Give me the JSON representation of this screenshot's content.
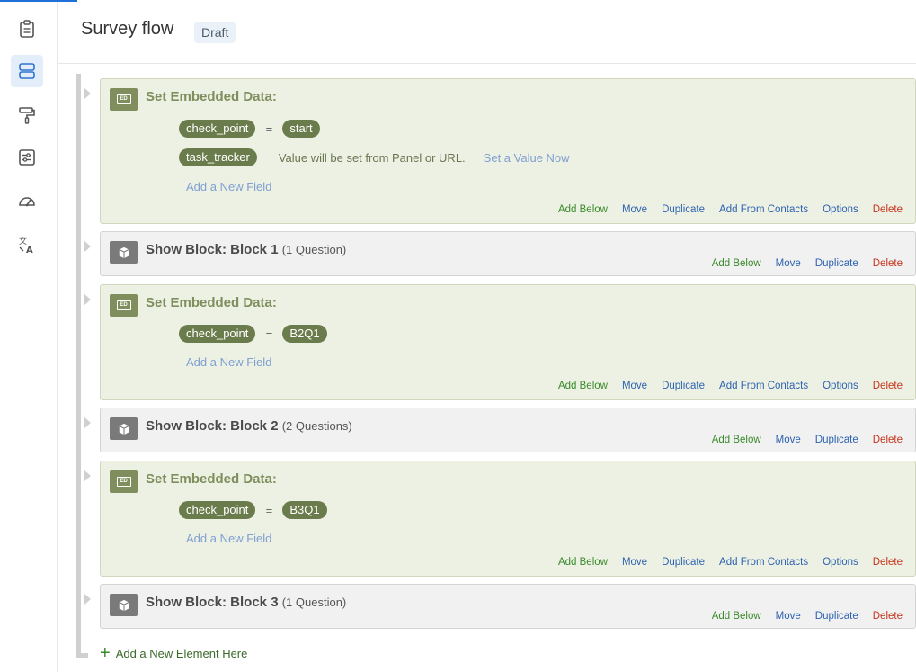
{
  "rail": {
    "items": [
      {
        "icon": "clipboard-icon",
        "active": false
      },
      {
        "icon": "survey-flow-icon",
        "active": true
      },
      {
        "icon": "paint-roller-icon",
        "active": false
      },
      {
        "icon": "survey-options-icon",
        "active": false
      },
      {
        "icon": "gauge-icon",
        "active": false
      },
      {
        "icon": "translate-icon",
        "active": false
      }
    ],
    "accent_color": "#1e6fd9"
  },
  "header": {
    "title": "Survey flow",
    "badge": "Draft"
  },
  "cards": [
    {
      "type": "embedded-data",
      "icon_text": "ED",
      "title": "Set Embedded Data:",
      "fields": [
        {
          "name": "check_point",
          "eq": "=",
          "value": "start"
        },
        {
          "name": "task_tracker",
          "note": "Value will be set from Panel or URL.",
          "link": "Set a Value Now"
        }
      ],
      "add_field": "Add a New Field",
      "actions": {
        "add_below": "Add Below",
        "move": "Move",
        "duplicate": "Duplicate",
        "add_from_contacts": "Add From Contacts",
        "options": "Options",
        "delete": "Delete"
      }
    },
    {
      "type": "block",
      "title": "Show Block: Block 1",
      "qcount": "(1 Question)",
      "actions": {
        "add_below": "Add Below",
        "move": "Move",
        "duplicate": "Duplicate",
        "delete": "Delete"
      }
    },
    {
      "type": "embedded-data",
      "icon_text": "ED",
      "title": "Set Embedded Data:",
      "fields": [
        {
          "name": "check_point",
          "eq": "=",
          "value": "B2Q1"
        }
      ],
      "add_field": "Add a New Field",
      "actions": {
        "add_below": "Add Below",
        "move": "Move",
        "duplicate": "Duplicate",
        "add_from_contacts": "Add From Contacts",
        "options": "Options",
        "delete": "Delete"
      }
    },
    {
      "type": "block",
      "title": "Show Block: Block 2",
      "qcount": "(2 Questions)",
      "actions": {
        "add_below": "Add Below",
        "move": "Move",
        "duplicate": "Duplicate",
        "delete": "Delete"
      }
    },
    {
      "type": "embedded-data",
      "icon_text": "ED",
      "title": "Set Embedded Data:",
      "fields": [
        {
          "name": "check_point",
          "eq": "=",
          "value": "B3Q1"
        }
      ],
      "add_field": "Add a New Field",
      "actions": {
        "add_below": "Add Below",
        "move": "Move",
        "duplicate": "Duplicate",
        "add_from_contacts": "Add From Contacts",
        "options": "Options",
        "delete": "Delete"
      }
    },
    {
      "type": "block",
      "title": "Show Block: Block 3",
      "qcount": "(1 Question)",
      "actions": {
        "add_below": "Add Below",
        "move": "Move",
        "duplicate": "Duplicate",
        "delete": "Delete"
      }
    }
  ],
  "footer": {
    "add_element": "Add a New Element Here"
  },
  "colors": {
    "ed_background": "#edf1e4",
    "ed_accent": "#7f8e5c",
    "pill": "#6b7c4c",
    "block_background": "#f1f1f1",
    "link": "#2d62b0",
    "add": "#3a8a2a",
    "delete": "#c4321b"
  }
}
